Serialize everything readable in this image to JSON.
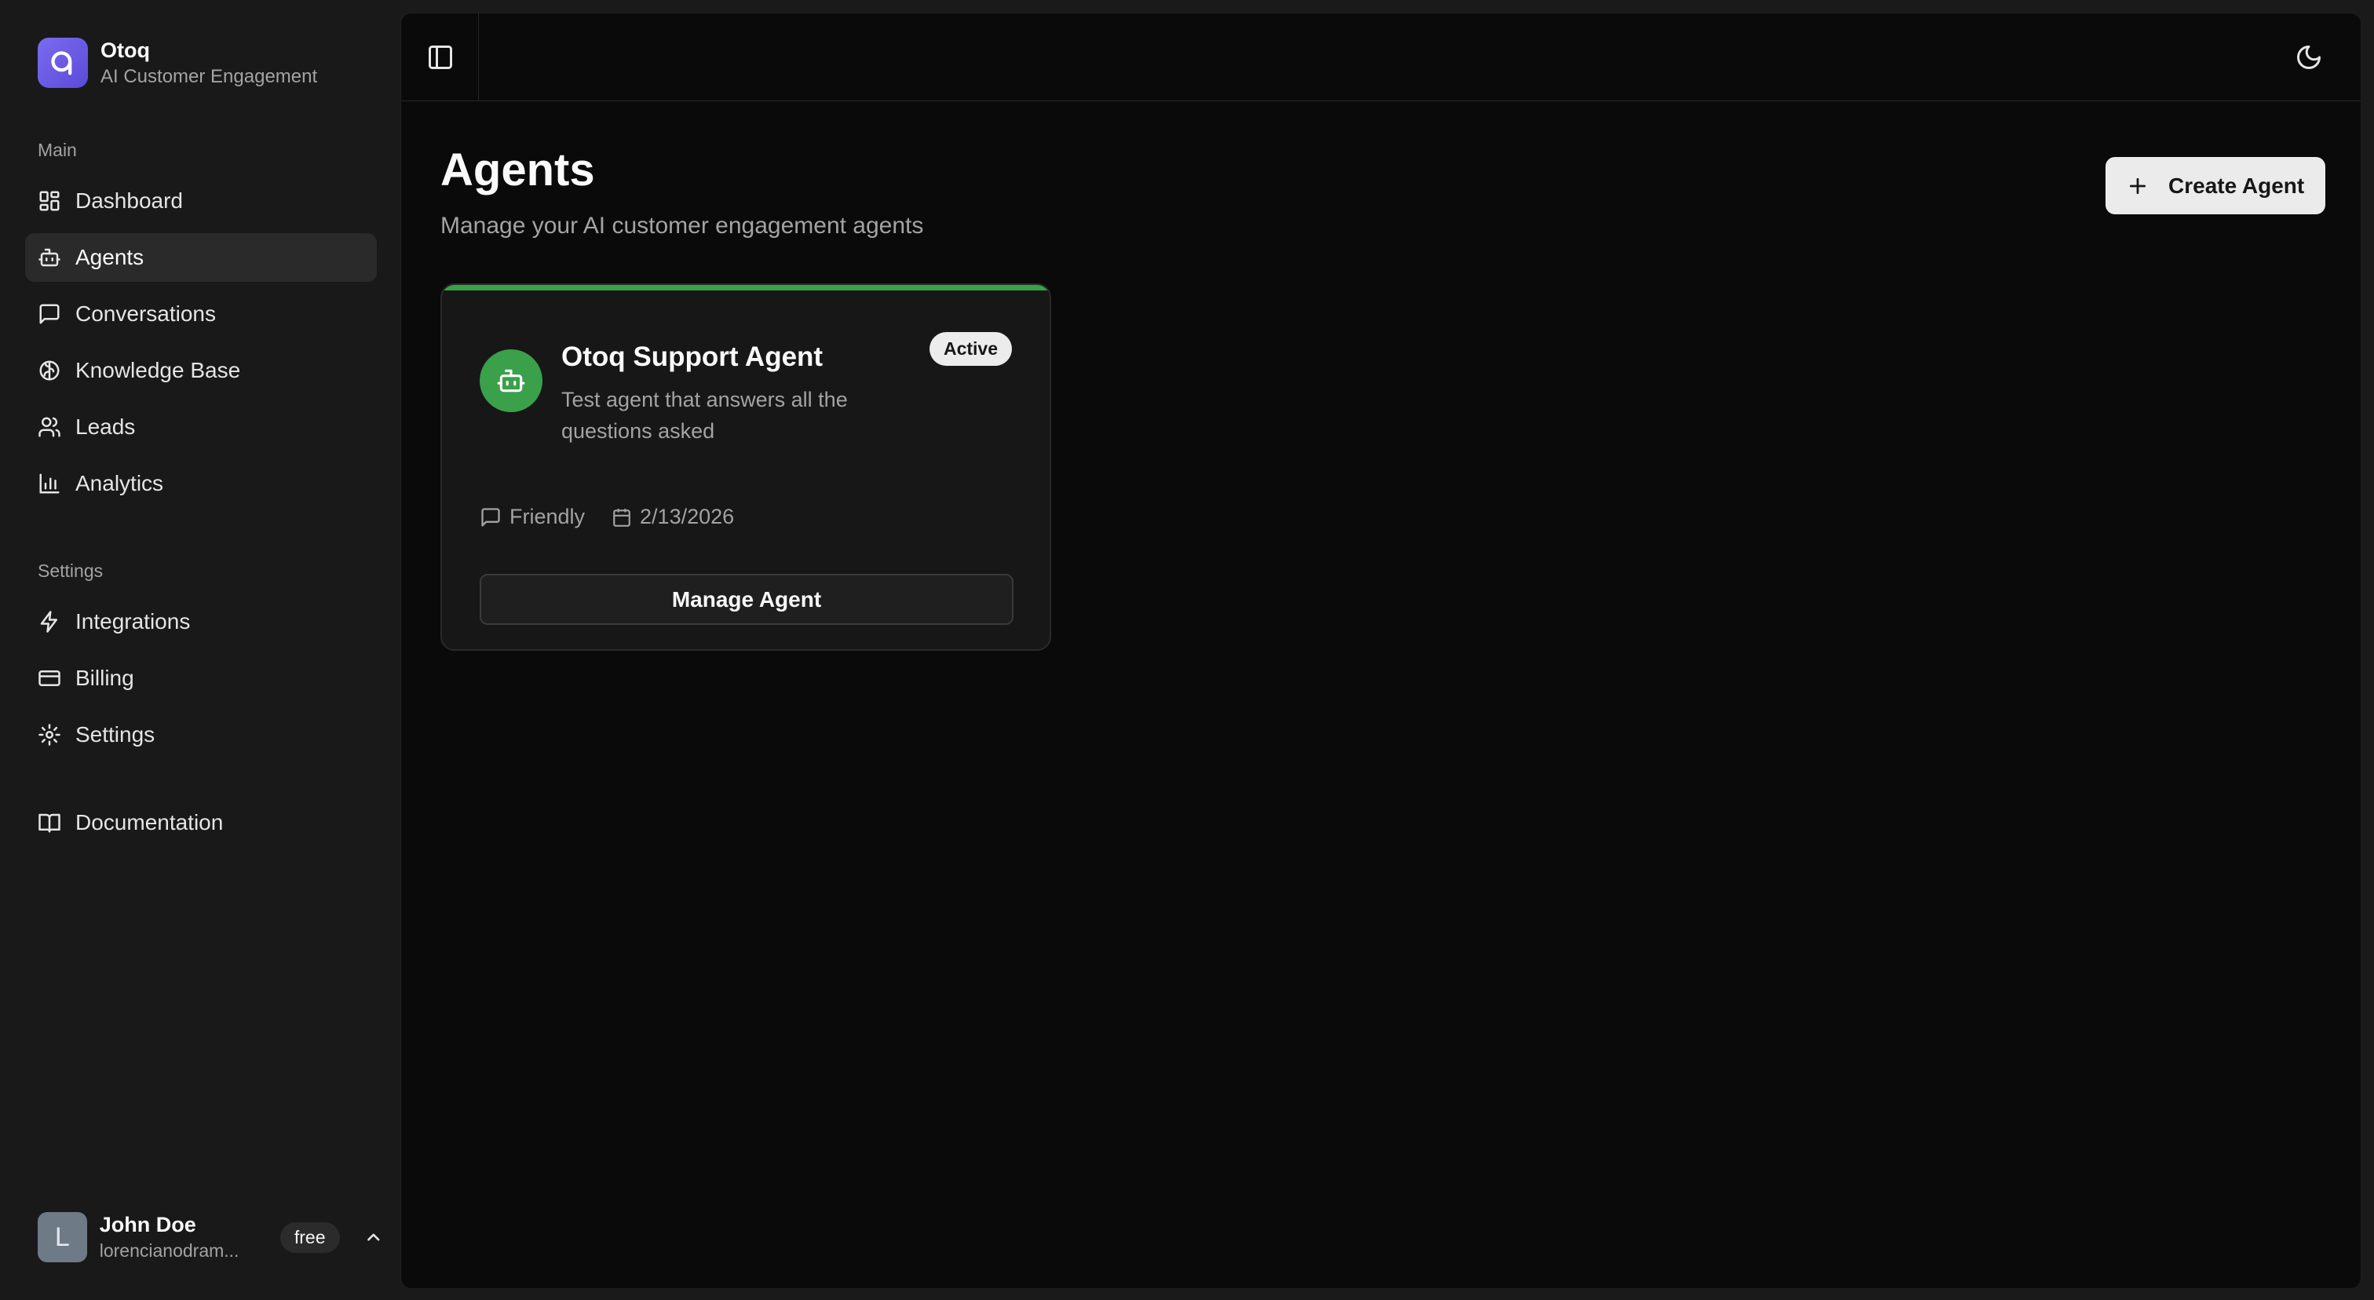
{
  "brand": {
    "name": "Otoq",
    "subtitle": "AI Customer Engagement"
  },
  "sidebar": {
    "main_label": "Main",
    "main_items": [
      {
        "label": "Dashboard",
        "icon": "dashboard-icon"
      },
      {
        "label": "Agents",
        "icon": "bot-icon",
        "active": true
      },
      {
        "label": "Conversations",
        "icon": "message-icon"
      },
      {
        "label": "Knowledge Base",
        "icon": "brain-icon"
      },
      {
        "label": "Leads",
        "icon": "users-icon"
      },
      {
        "label": "Analytics",
        "icon": "bar-chart-icon"
      }
    ],
    "settings_label": "Settings",
    "settings_items": [
      {
        "label": "Integrations",
        "icon": "zap-icon"
      },
      {
        "label": "Billing",
        "icon": "credit-card-icon"
      },
      {
        "label": "Settings",
        "icon": "gear-icon"
      }
    ],
    "docs_item": {
      "label": "Documentation",
      "icon": "book-icon"
    }
  },
  "user": {
    "initial": "L",
    "name": "John Doe",
    "email": "lorencianodram...",
    "plan": "free"
  },
  "page": {
    "title": "Agents",
    "subtitle": "Manage your AI customer engagement agents",
    "create_button": "Create Agent"
  },
  "agent": {
    "name": "Otoq Support Agent",
    "description": "Test agent that answers all the questions asked",
    "status": "Active",
    "tone": "Friendly",
    "date": "2/13/2026",
    "manage_button": "Manage Agent",
    "accent_color": "#3aa04a"
  },
  "colors": {
    "brand": "#6a5ae6",
    "active_green": "#3aa04a"
  }
}
